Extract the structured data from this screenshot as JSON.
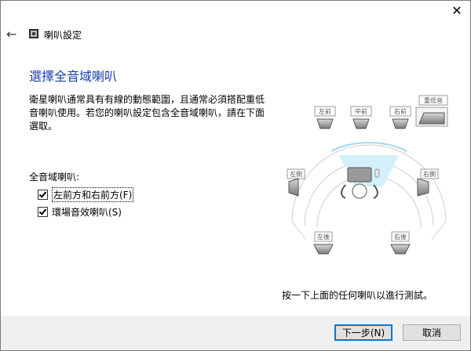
{
  "window": {
    "title": "喇叭設定",
    "close_glyph": "✕",
    "back_glyph": "←"
  },
  "page": {
    "heading": "選擇全音域喇叭",
    "description": "衛星喇叭通常具有有線的動態範圍，且通常必須搭配重低音喇叭使用。若您的喇叭設定包含全音域喇叭，請在下面選取。",
    "group_label": "全音域喇叭:",
    "checkboxes": [
      {
        "label": "左前方和右前方(F)",
        "checked": true
      },
      {
        "label": "環場音效喇叭(S)",
        "checked": true
      }
    ],
    "hint": "按一下上面的任何喇叭以進行測試。"
  },
  "speakers": {
    "front_left": "左前",
    "center": "中前",
    "front_right": "右前",
    "subwoofer": "重低音",
    "side_left": "左側",
    "side_right": "右側",
    "rear_left": "左後",
    "rear_right": "右後"
  },
  "buttons": {
    "next": "下一步(N)",
    "cancel": "取消"
  },
  "colors": {
    "heading": "#1a3ea6",
    "highlight": "#cfeefb",
    "accent": "#0078d7"
  }
}
